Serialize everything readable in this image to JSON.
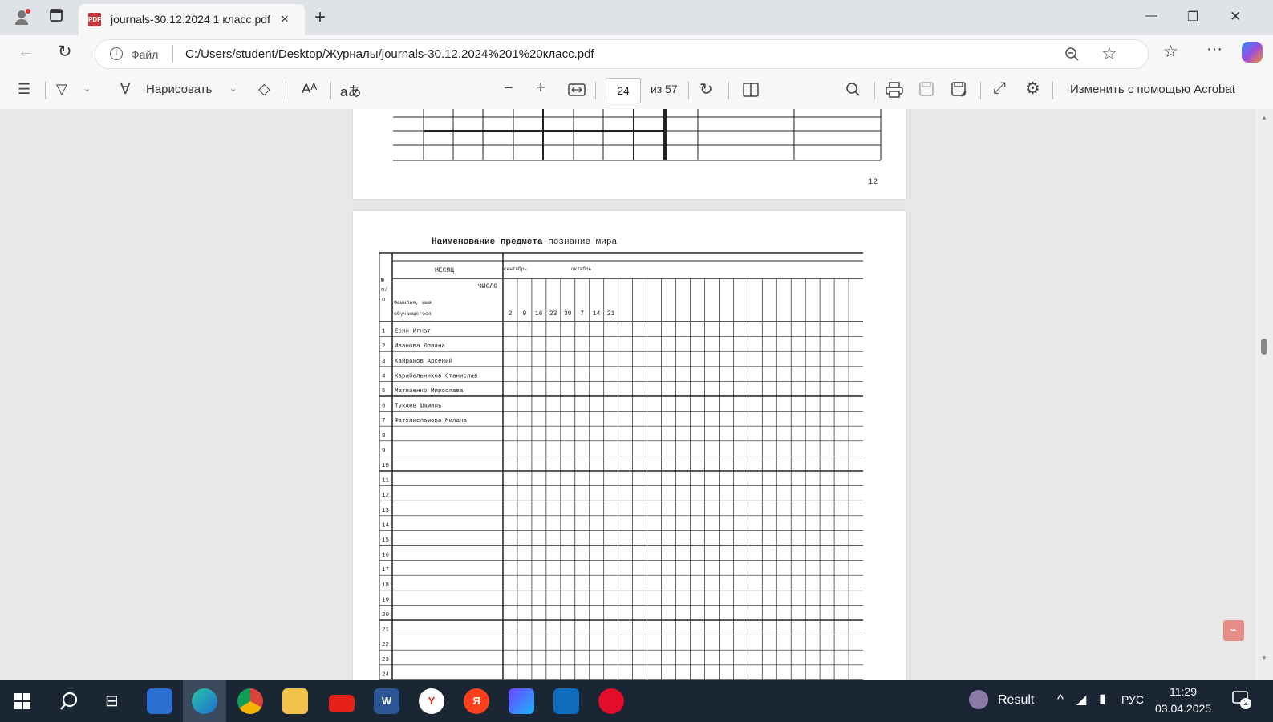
{
  "tab": {
    "title": "journals-30.12.2024 1 класс.pdf",
    "close": "×",
    "new_tab": "+"
  },
  "window": {
    "minimize": "—",
    "restore": "❐",
    "close": "✕"
  },
  "address": {
    "file_label": "Файл",
    "url": "C:/Users/student/Desktop/Журналы/journals-30.12.2024%201%20класс.pdf"
  },
  "pdf_toolbar": {
    "draw_label": "Нарисовать",
    "page_current": "24",
    "page_total": "из 57",
    "acrobat_label": "Изменить с помощью Acrobat"
  },
  "prev_page": {
    "page_number": "12"
  },
  "page": {
    "title_bold": "Наименование предмета",
    "title_subject": "познание мира",
    "header_month": "МЕСЯЦ",
    "header_day": "ЧИСЛО",
    "header_num": "№ п/п",
    "header_name": "Фамилия, имя обучающегося",
    "months": [
      "сентябрь",
      "октябрь"
    ],
    "dates": [
      "2",
      "9",
      "16",
      "23",
      "30",
      "7",
      "14",
      "21"
    ],
    "students": [
      {
        "n": "1",
        "name": "Есин Игнат"
      },
      {
        "n": "2",
        "name": "Иванова Юлиана"
      },
      {
        "n": "3",
        "name": "Кайраков Арсений"
      },
      {
        "n": "4",
        "name": "Карабельников Станислав"
      },
      {
        "n": "5",
        "name": "Матвиенко Мирослава"
      },
      {
        "n": "6",
        "name": "Тукаев Шамиль"
      },
      {
        "n": "7",
        "name": "Фатхлисламова Милана"
      },
      {
        "n": "8",
        "name": ""
      },
      {
        "n": "9",
        "name": ""
      },
      {
        "n": "10",
        "name": ""
      },
      {
        "n": "11",
        "name": ""
      },
      {
        "n": "12",
        "name": ""
      },
      {
        "n": "13",
        "name": ""
      },
      {
        "n": "14",
        "name": ""
      },
      {
        "n": "15",
        "name": ""
      },
      {
        "n": "16",
        "name": ""
      },
      {
        "n": "17",
        "name": ""
      },
      {
        "n": "18",
        "name": ""
      },
      {
        "n": "19",
        "name": ""
      },
      {
        "n": "20",
        "name": ""
      },
      {
        "n": "21",
        "name": ""
      },
      {
        "n": "22",
        "name": ""
      },
      {
        "n": "23",
        "name": ""
      },
      {
        "n": "24",
        "name": ""
      }
    ]
  },
  "taskbar": {
    "apps": [
      "windows-start",
      "search",
      "task-view",
      "store",
      "edge",
      "chrome",
      "file-explorer",
      "youtube",
      "word",
      "yandex-browser",
      "yandex",
      "video-editor",
      "outlook",
      "opera"
    ],
    "weather_label": "Result",
    "lang": "РУС",
    "time": "11:29",
    "date": "03.04.2025",
    "notif_count": "2"
  }
}
